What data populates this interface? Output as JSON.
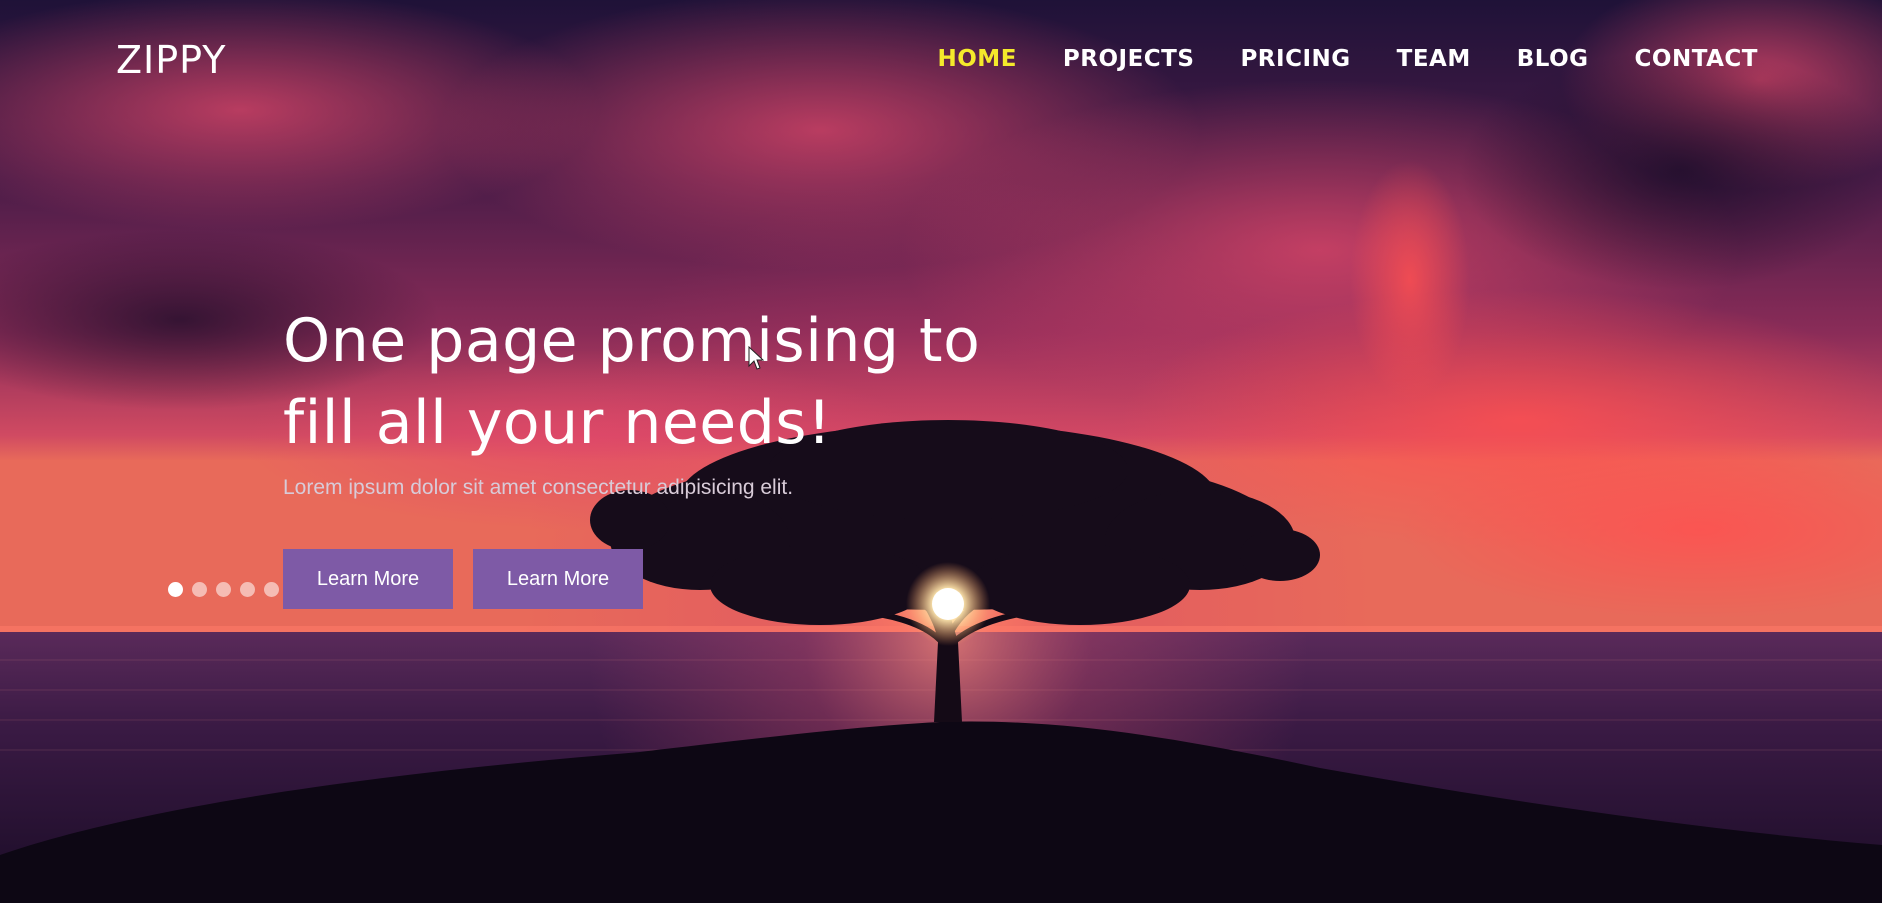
{
  "brand": {
    "logo_text": "ZIPPY"
  },
  "nav": {
    "items": [
      {
        "label": "HOME",
        "active": true
      },
      {
        "label": "PROJECTS",
        "active": false
      },
      {
        "label": "PRICING",
        "active": false
      },
      {
        "label": "TEAM",
        "active": false
      },
      {
        "label": "BLOG",
        "active": false
      },
      {
        "label": "CONTACT",
        "active": false
      }
    ],
    "active_color": "#f4ea2b",
    "text_color": "#ffffff"
  },
  "hero": {
    "title_line_1": "One page promising to",
    "title_line_2": "fill all your needs!",
    "subtitle": "Lorem ipsum dolor sit amet consectetur adipisicing elit.",
    "buttons": [
      {
        "label": "Learn More"
      },
      {
        "label": "Learn More"
      }
    ],
    "button_color": "#7e5aa6"
  },
  "slider": {
    "dot_count": 6,
    "active_index": 0
  },
  "icons": {
    "cursor": "mouse-pointer-icon"
  }
}
